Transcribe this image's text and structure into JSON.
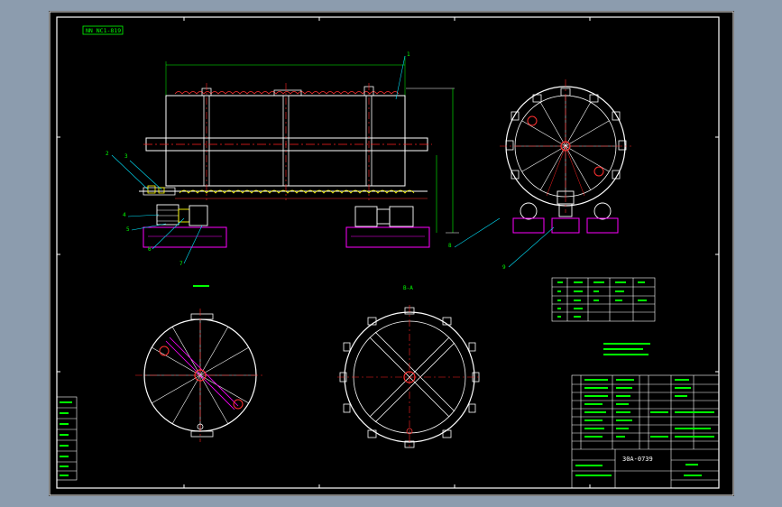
{
  "colors": {
    "background": "#000000",
    "window": "#8c9cae",
    "frame": "#ffffff",
    "annotation": "#00ff00",
    "centerline": "#ff2020",
    "leader": "#00e5ff",
    "support": "#ff00ff",
    "detail": "#ffff00"
  },
  "drawing": {
    "title_tag": "NN NC1-819",
    "section_label": "B-A",
    "drawing_number": "30A-0739",
    "part_numbers": [
      "1",
      "2",
      "3",
      "4",
      "5",
      "6",
      "7",
      "8",
      "9"
    ]
  },
  "icons": [
    "anchor-plate-icon",
    "reducer-icon",
    "motor-icon"
  ]
}
